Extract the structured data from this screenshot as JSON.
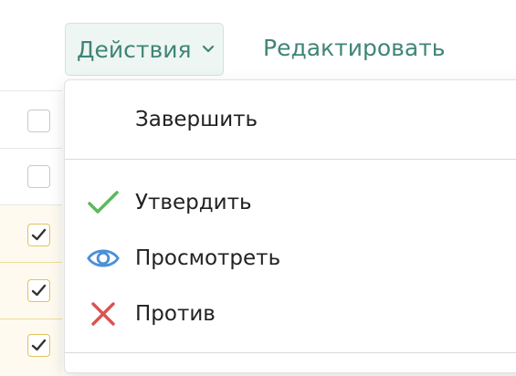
{
  "toolbar": {
    "actions_label": "Действия",
    "actions_icon": "chevron-down-icon",
    "edit_label": "Редактировать",
    "accent_color": "#3f8576"
  },
  "table": {
    "rows": [
      {
        "checked": false
      },
      {
        "checked": false
      },
      {
        "checked": true
      },
      {
        "checked": true
      },
      {
        "checked": true
      }
    ]
  },
  "menu": {
    "items": [
      {
        "label": "Завершить",
        "icon": ""
      },
      {
        "label": "Утвердить",
        "icon": "checkmark-icon",
        "icon_color": "#5cb85c"
      },
      {
        "label": "Просмотреть",
        "icon": "eye-icon",
        "icon_color": "#4a90d9"
      },
      {
        "label": "Против",
        "icon": "cross-icon",
        "icon_color": "#d9534f"
      }
    ]
  }
}
